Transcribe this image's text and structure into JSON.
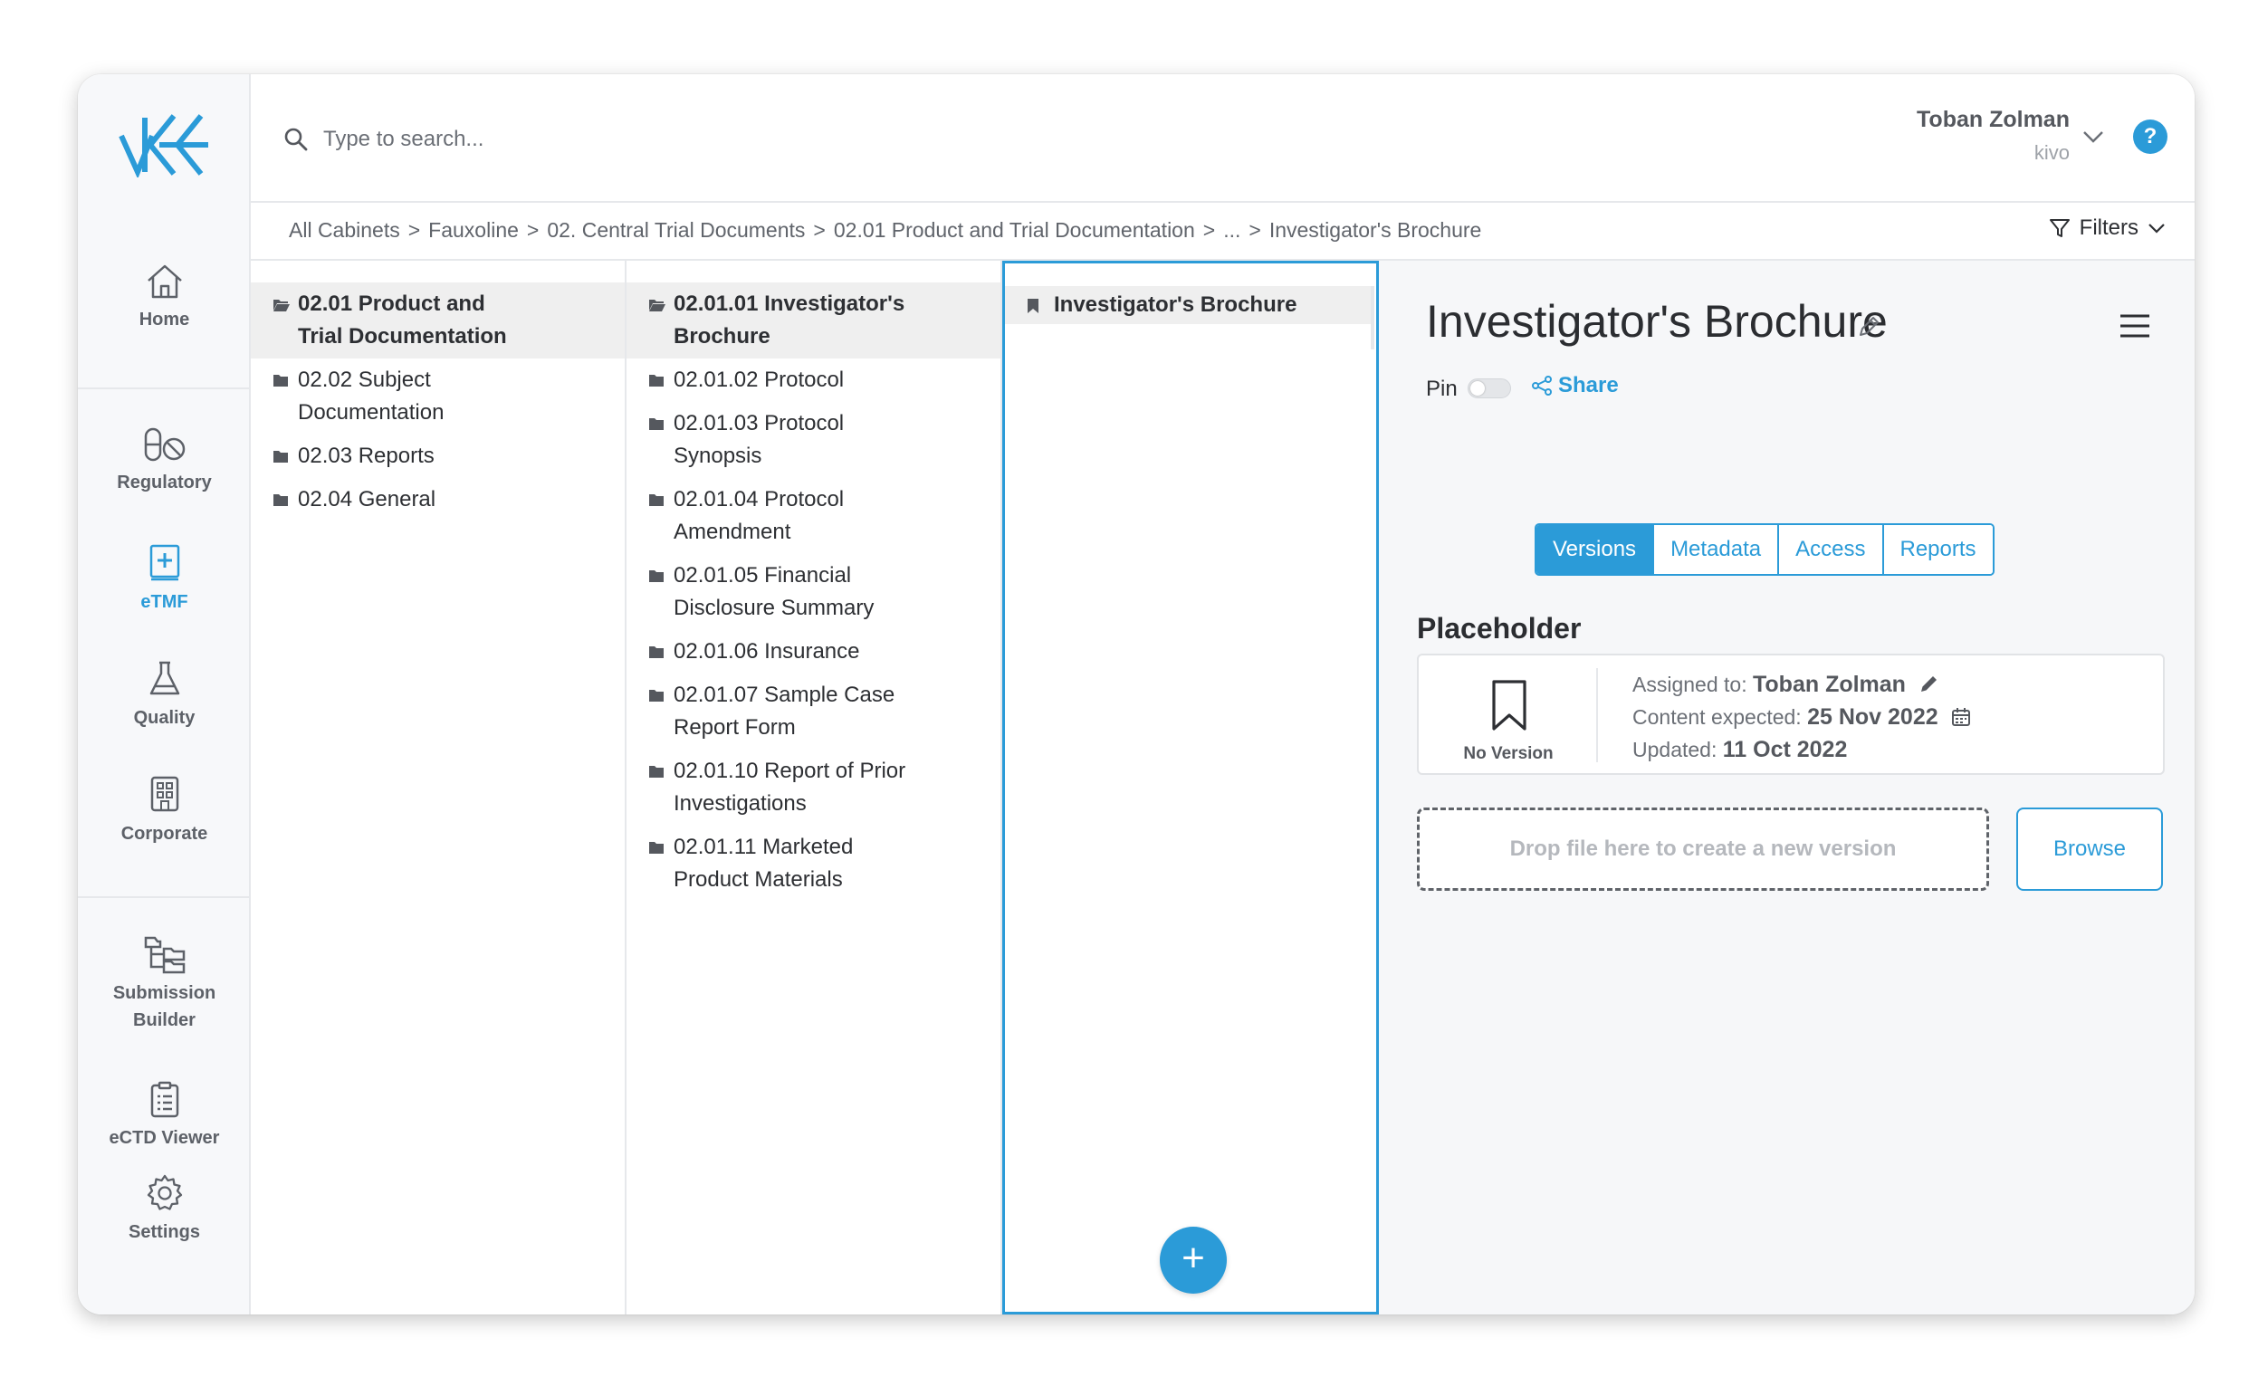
{
  "sidebar": {
    "logo_icon": "kivo-logo-icon",
    "items": [
      {
        "label": "Home",
        "icon": "home-icon"
      },
      {
        "label": "Regulatory",
        "icon": "pills-icon"
      },
      {
        "label": "eTMF",
        "icon": "binder-plus-icon",
        "active": true
      },
      {
        "label": "Quality",
        "icon": "flask-icon"
      },
      {
        "label": "Corporate",
        "icon": "building-icon"
      },
      {
        "label": "Submission",
        "label2": "Builder",
        "icon": "folder-tree-icon"
      },
      {
        "label": "eCTD Viewer",
        "icon": "clipboard-list-icon"
      },
      {
        "label": "Settings",
        "icon": "gear-icon"
      }
    ]
  },
  "header": {
    "search_placeholder": "Type to search...",
    "user_name": "Toban Zolman",
    "user_org": "kivo",
    "help_label": "?"
  },
  "breadcrumb": {
    "items": [
      "All Cabinets",
      "Fauxoline",
      "02. Central Trial Documents",
      "02.01 Product and Trial Documentation",
      "...",
      "Investigator's Brochure"
    ],
    "separator": ">",
    "filters_label": "Filters"
  },
  "columns": {
    "col1": [
      {
        "line1": "02.01 Product and",
        "line2": "Trial Documentation",
        "selected": true
      },
      {
        "line1": "02.02 Subject",
        "line2": "Documentation"
      },
      {
        "line1": "02.03 Reports"
      },
      {
        "line1": "02.04 General"
      }
    ],
    "col2": [
      {
        "line1": "02.01.01 Investigator's",
        "line2": "Brochure",
        "selected": true
      },
      {
        "line1": "02.01.02 Protocol"
      },
      {
        "line1": "02.01.03 Protocol",
        "line2": "Synopsis"
      },
      {
        "line1": "02.01.04 Protocol",
        "line2": "Amendment"
      },
      {
        "line1": "02.01.05 Financial",
        "line2": "Disclosure Summary"
      },
      {
        "line1": "02.01.06 Insurance"
      },
      {
        "line1": "02.01.07 Sample Case",
        "line2": "Report Form"
      },
      {
        "line1": "02.01.10 Report of Prior",
        "line2": "Investigations"
      },
      {
        "line1": "02.01.11 Marketed",
        "line2": "Product Materials"
      }
    ],
    "col3": [
      {
        "label": "Investigator's Brochure"
      }
    ],
    "add_label": "+"
  },
  "detail": {
    "title": "Investigator's Brochure",
    "pin_label": "Pin",
    "share_label": "Share",
    "tabs": [
      "Versions",
      "Metadata",
      "Access",
      "Reports"
    ],
    "active_tab": "Versions",
    "section_title": "Placeholder",
    "placeholder": {
      "status": "No Version",
      "assigned_label": "Assigned to:",
      "assigned_value": "Toban Zolman",
      "expected_label": "Content expected:",
      "expected_value": "25 Nov 2022",
      "updated_label": "Updated:",
      "updated_value": "11 Oct 2022"
    },
    "dropzone_text": "Drop file here to create a new version",
    "browse_label": "Browse"
  },
  "colors": {
    "accent": "#2b9bd8",
    "selected_row": "#efefef",
    "panel_bg": "#f6f7f9"
  }
}
